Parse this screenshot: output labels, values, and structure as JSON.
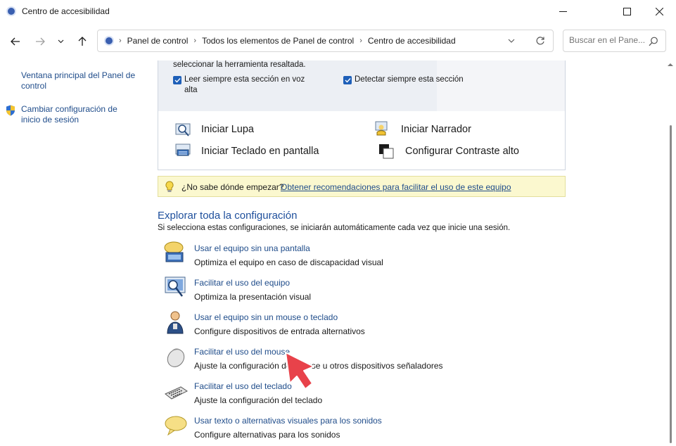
{
  "window": {
    "title": "Centro de accesibilidad",
    "icon": "control-panel-icon"
  },
  "nav": {
    "breadcrumbs": [
      "Panel de control",
      "Todos los elementos de Panel de control",
      "Centro de accesibilidad"
    ],
    "search_placeholder": "Buscar en el Pane..."
  },
  "sidebar": {
    "items": [
      {
        "label_line1": "Ventana principal del Panel de",
        "label_line2": "control"
      },
      {
        "label_line1": "Cambiar configuración de",
        "label_line2": "inicio de sesión",
        "icon": "uac-shield-icon"
      }
    ]
  },
  "top_panel": {
    "partial_text": "seleccionar la herramienta resaltada.",
    "checkboxes": [
      {
        "label_line1": "Leer siempre esta sección en voz",
        "label_line2": "alta",
        "checked": true
      },
      {
        "label_line1": "Detectar siempre esta sección",
        "checked": true
      }
    ],
    "tools": [
      {
        "label": "Iniciar Lupa",
        "icon": "magnifier-icon"
      },
      {
        "label": "Iniciar Narrador",
        "icon": "narrator-icon"
      },
      {
        "label": "Iniciar Teclado en pantalla",
        "icon": "onscreen-keyboard-icon"
      },
      {
        "label": "Configurar Contraste alto",
        "icon": "high-contrast-icon"
      }
    ]
  },
  "hint": {
    "question": "¿No sabe dónde empezar?",
    "link": "Obtener recomendaciones para facilitar el uso de este equipo"
  },
  "explore": {
    "title": "Explorar toda la configuración",
    "description": "Si selecciona estas configuraciones, se iniciarán automáticamente cada vez que inicie una sesión.",
    "items": [
      {
        "link": "Usar el equipo sin una pantalla",
        "desc": "Optimiza el equipo en caso de discapacidad visual",
        "icon": "no-display-icon"
      },
      {
        "link": "Facilitar el uso del equipo",
        "desc": "Optimiza la presentación visual",
        "icon": "monitor-magnifier-icon"
      },
      {
        "link": "Usar el equipo sin un mouse o teclado",
        "desc": "Configure dispositivos de entrada alternativos",
        "icon": "person-icon"
      },
      {
        "link": "Facilitar el uso del mouse",
        "desc": "Ajuste la configuración del mouse u otros dispositivos señaladores",
        "icon": "mouse-icon"
      },
      {
        "link": "Facilitar el uso del teclado",
        "desc": "Ajuste la configuración del teclado",
        "icon": "keyboard-icon"
      },
      {
        "link": "Usar texto o alternativas visuales para los sonidos",
        "desc": "Configure alternativas para los sonidos",
        "icon": "speech-bubble-icon"
      }
    ]
  },
  "colors": {
    "link": "#1f4c8a",
    "section_title": "#1e4f9c",
    "hint_background": "#fbf8cf",
    "checkbox": "#1e5fb8",
    "pointer": "#e8424a"
  }
}
